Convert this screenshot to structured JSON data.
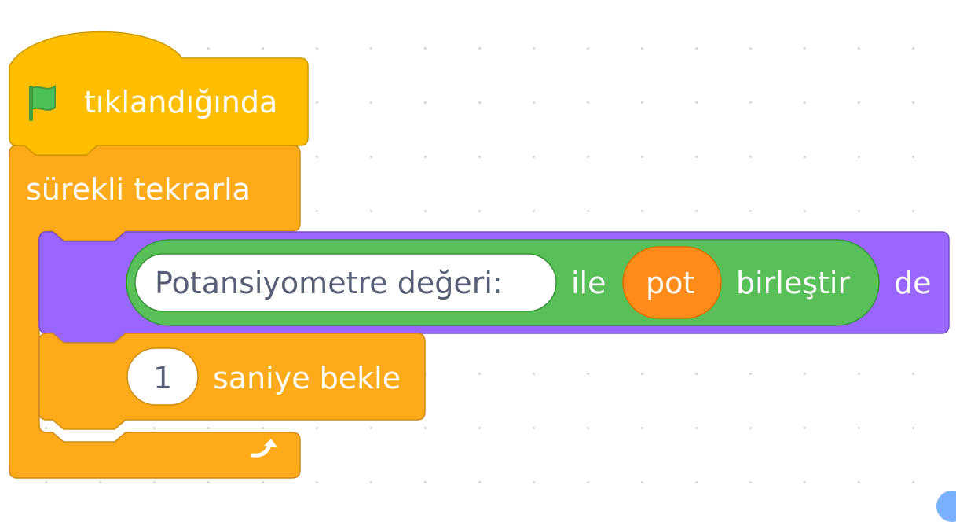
{
  "colors": {
    "events": "#ffbf00",
    "events_border": "#cc9900",
    "control": "#ffab19",
    "control_border": "#cf8b17",
    "looks": "#9966ff",
    "looks_border": "#774dcb",
    "operators": "#59c059",
    "operators_border": "#389438",
    "variable_reporter": "#ff8c1a",
    "variable_border": "#db6e00",
    "flag_green": "#4cbf56",
    "flag_dark": "#45993d",
    "field_text": "#575e75"
  },
  "blocks": {
    "hat": {
      "icon": "green-flag-icon",
      "label": "tıklandığında"
    },
    "forever": {
      "label": "sürekli tekrarla",
      "loop_icon": "loop-arrow-icon"
    },
    "say": {
      "join": {
        "input1": "Potansiyometre değeri:",
        "middle_label": "ile",
        "variable": "pot",
        "end_label": "birleştir"
      },
      "label": "de"
    },
    "wait": {
      "value": "1",
      "label": "saniye bekle"
    }
  }
}
